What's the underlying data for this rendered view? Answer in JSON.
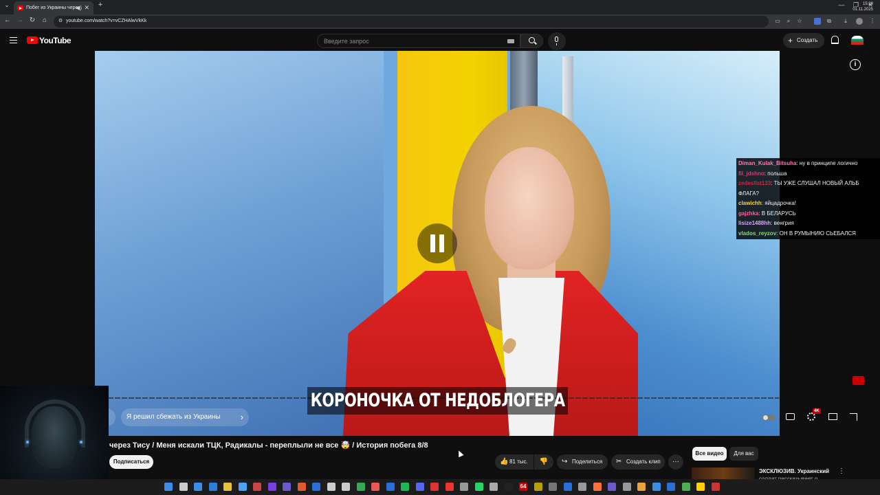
{
  "browser": {
    "tab_title": "Побег из Украины через",
    "url": "youtube.com/watch?v=vCZHAlwVkKk",
    "window_min": "—",
    "window_max": "❐",
    "window_close": "✕"
  },
  "header": {
    "logo_text": "YouTube",
    "search_placeholder": "Введите запрос",
    "create_label": "Создать"
  },
  "player": {
    "caption": "КОРОНОЧКА ОТ НЕДОБЛОГЕРА",
    "chapter_label": "Я решил сбежать из Украины",
    "quality_badge": "4K",
    "state": "paused"
  },
  "chat": [
    {
      "user": "Diman_Kulak_Bitsuha",
      "text": "ну в принципе логично",
      "color": "#ff7ab8"
    },
    {
      "user": "fil_jdshno",
      "text": "польша",
      "color": "#e0357a"
    },
    {
      "user": "zedesllst133",
      "text": "ТЫ УЖЕ СЛУШАЛ НОВЫЙ АЛЬБ",
      "color": "#d02640"
    },
    {
      "user": "",
      "text": "ФЛАГА?",
      "color": "#ffffff"
    },
    {
      "user": "clawichh",
      "text": "яйцадрочка!",
      "color": "#ffd23f"
    },
    {
      "user": "gajzhka",
      "text": "В БЕЛАРУСЬ",
      "color": "#ff5fa2"
    },
    {
      "user": "lisize1488hh",
      "text": "венгрия",
      "color": "#d9a6ff"
    },
    {
      "user": "vlados_reyzov",
      "text": "ОН В РУМЫНИЮ СЬЕБАЛСЯ",
      "color": "#7ee06a"
    }
  ],
  "video": {
    "title": "через Тису / Меня искали ТЦК, Радикалы - переплыли не все 🤯 / История побега 8/8",
    "subscribe_label": "Подписаться",
    "likes": "81 тыс.",
    "share_label": "Поделиться",
    "clip_label": "Создать клип",
    "more_label": "···"
  },
  "sidebar": {
    "chips": [
      "Все видео",
      "Для вас"
    ],
    "rec_title": "ЭКСКЛЮЗИВ. Украинский",
    "rec_sub": "солдат рассказывает о",
    "rec_menu": "⋮"
  },
  "taskbar": {
    "time": "15:29",
    "date": "01.11.2025",
    "badge": "64"
  },
  "colors": {
    "yt_red": "#ff0000",
    "background": "#0f0f0f",
    "jacket": "#e22323"
  }
}
